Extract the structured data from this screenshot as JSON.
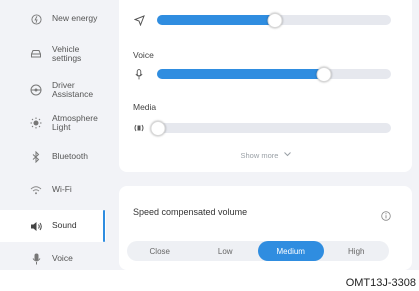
{
  "sidebar": {
    "items": [
      {
        "label": "New energy",
        "icon": "energy-icon"
      },
      {
        "label": "Vehicle\nsettings",
        "icon": "car-icon"
      },
      {
        "label": "Driver\nAssistance",
        "icon": "steering-wheel-icon"
      },
      {
        "label": "Atmosphere\nLight",
        "icon": "light-icon"
      },
      {
        "label": "Bluetooth",
        "icon": "bluetooth-icon"
      },
      {
        "label": "Wi-Fi",
        "icon": "wifi-icon"
      },
      {
        "label": "Sound",
        "icon": "speaker-icon",
        "active": true
      },
      {
        "label": "Voice",
        "icon": "microphone-icon"
      }
    ]
  },
  "volume": {
    "navigation": {
      "label": "",
      "icon": "navigation-arrow-icon",
      "level": 0.5
    },
    "voice": {
      "label": "Voice",
      "icon": "microphone-icon",
      "level": 0.71
    },
    "media": {
      "label": "Media",
      "icon": "speaker-waves-icon",
      "level": 0.0
    },
    "show_more": "Show more"
  },
  "speed_compensated": {
    "title": "Speed compensated volume",
    "options": [
      "Close",
      "Low",
      "Medium",
      "High"
    ],
    "selected": "Medium"
  },
  "figure_code": "OMT13J-3308",
  "colors": {
    "accent": "#2f8de0",
    "background": "#f2f3f7",
    "card": "#ffffff"
  }
}
